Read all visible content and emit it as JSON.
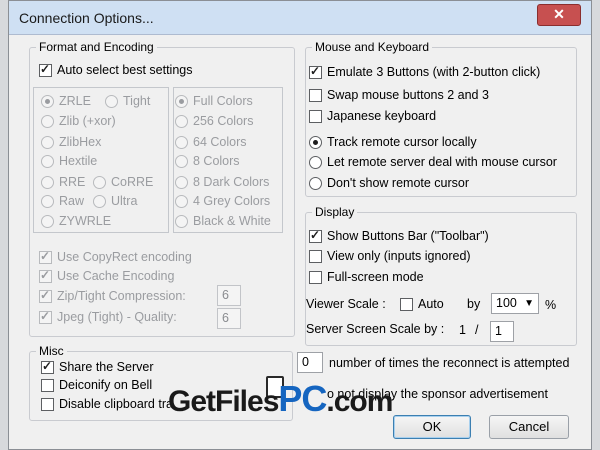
{
  "window": {
    "title": "Connection Options...",
    "close_label": "✕"
  },
  "format": {
    "title": "Format and Encoding",
    "auto_select": "Auto select best settings",
    "encodings": [
      "ZRLE",
      "Tight",
      "Zlib (+xor)",
      "ZlibHex",
      "Hextile",
      "RRE",
      "CoRRE",
      "Raw",
      "Ultra",
      "ZYWRLE"
    ],
    "colors": [
      "Full Colors",
      "256 Colors",
      "64 Colors",
      "8 Colors",
      "8 Dark Colors",
      "4 Grey Colors",
      "Black & White"
    ],
    "copyrect": "Use CopyRect encoding",
    "cache": "Use Cache Encoding",
    "zip": "Zip/Tight Compression:",
    "zip_value": "6",
    "jpeg": "Jpeg (Tight) - Quality:",
    "jpeg_value": "6"
  },
  "misc": {
    "title": "Misc",
    "share": "Share the Server",
    "deiconify": "Deiconify on Bell",
    "clipboard": "Disable clipboard tra"
  },
  "mouse": {
    "title": "Mouse and Keyboard",
    "emulate": "Emulate 3 Buttons (with 2-button click)",
    "swap": "Swap mouse buttons 2 and 3",
    "japanese": "Japanese keyboard",
    "track": "Track remote cursor locally",
    "let_server": "Let remote server deal with mouse cursor",
    "dont_show": "Don't show remote cursor"
  },
  "display": {
    "title": "Display",
    "toolbar": "Show Buttons Bar (\"Toolbar\")",
    "view_only": "View only (inputs ignored)",
    "fullscreen": "Full-screen mode",
    "viewer_scale": "Viewer Scale :",
    "auto": "Auto",
    "by": "by",
    "scale_value": "100",
    "percent": "%",
    "server_scale": "Server Screen Scale by :",
    "server_scale_num": "1",
    "slash": "/",
    "server_scale_value": "1"
  },
  "reconnect": {
    "value": "0",
    "label": "number of times the reconnect is attempted"
  },
  "sponsor": {
    "label": "o not display the sponsor advertisement"
  },
  "buttons": {
    "ok": "OK",
    "cancel": "Cancel"
  },
  "watermark": {
    "part1": "GetFiles",
    "part2": "PC",
    "part3": ".com"
  }
}
